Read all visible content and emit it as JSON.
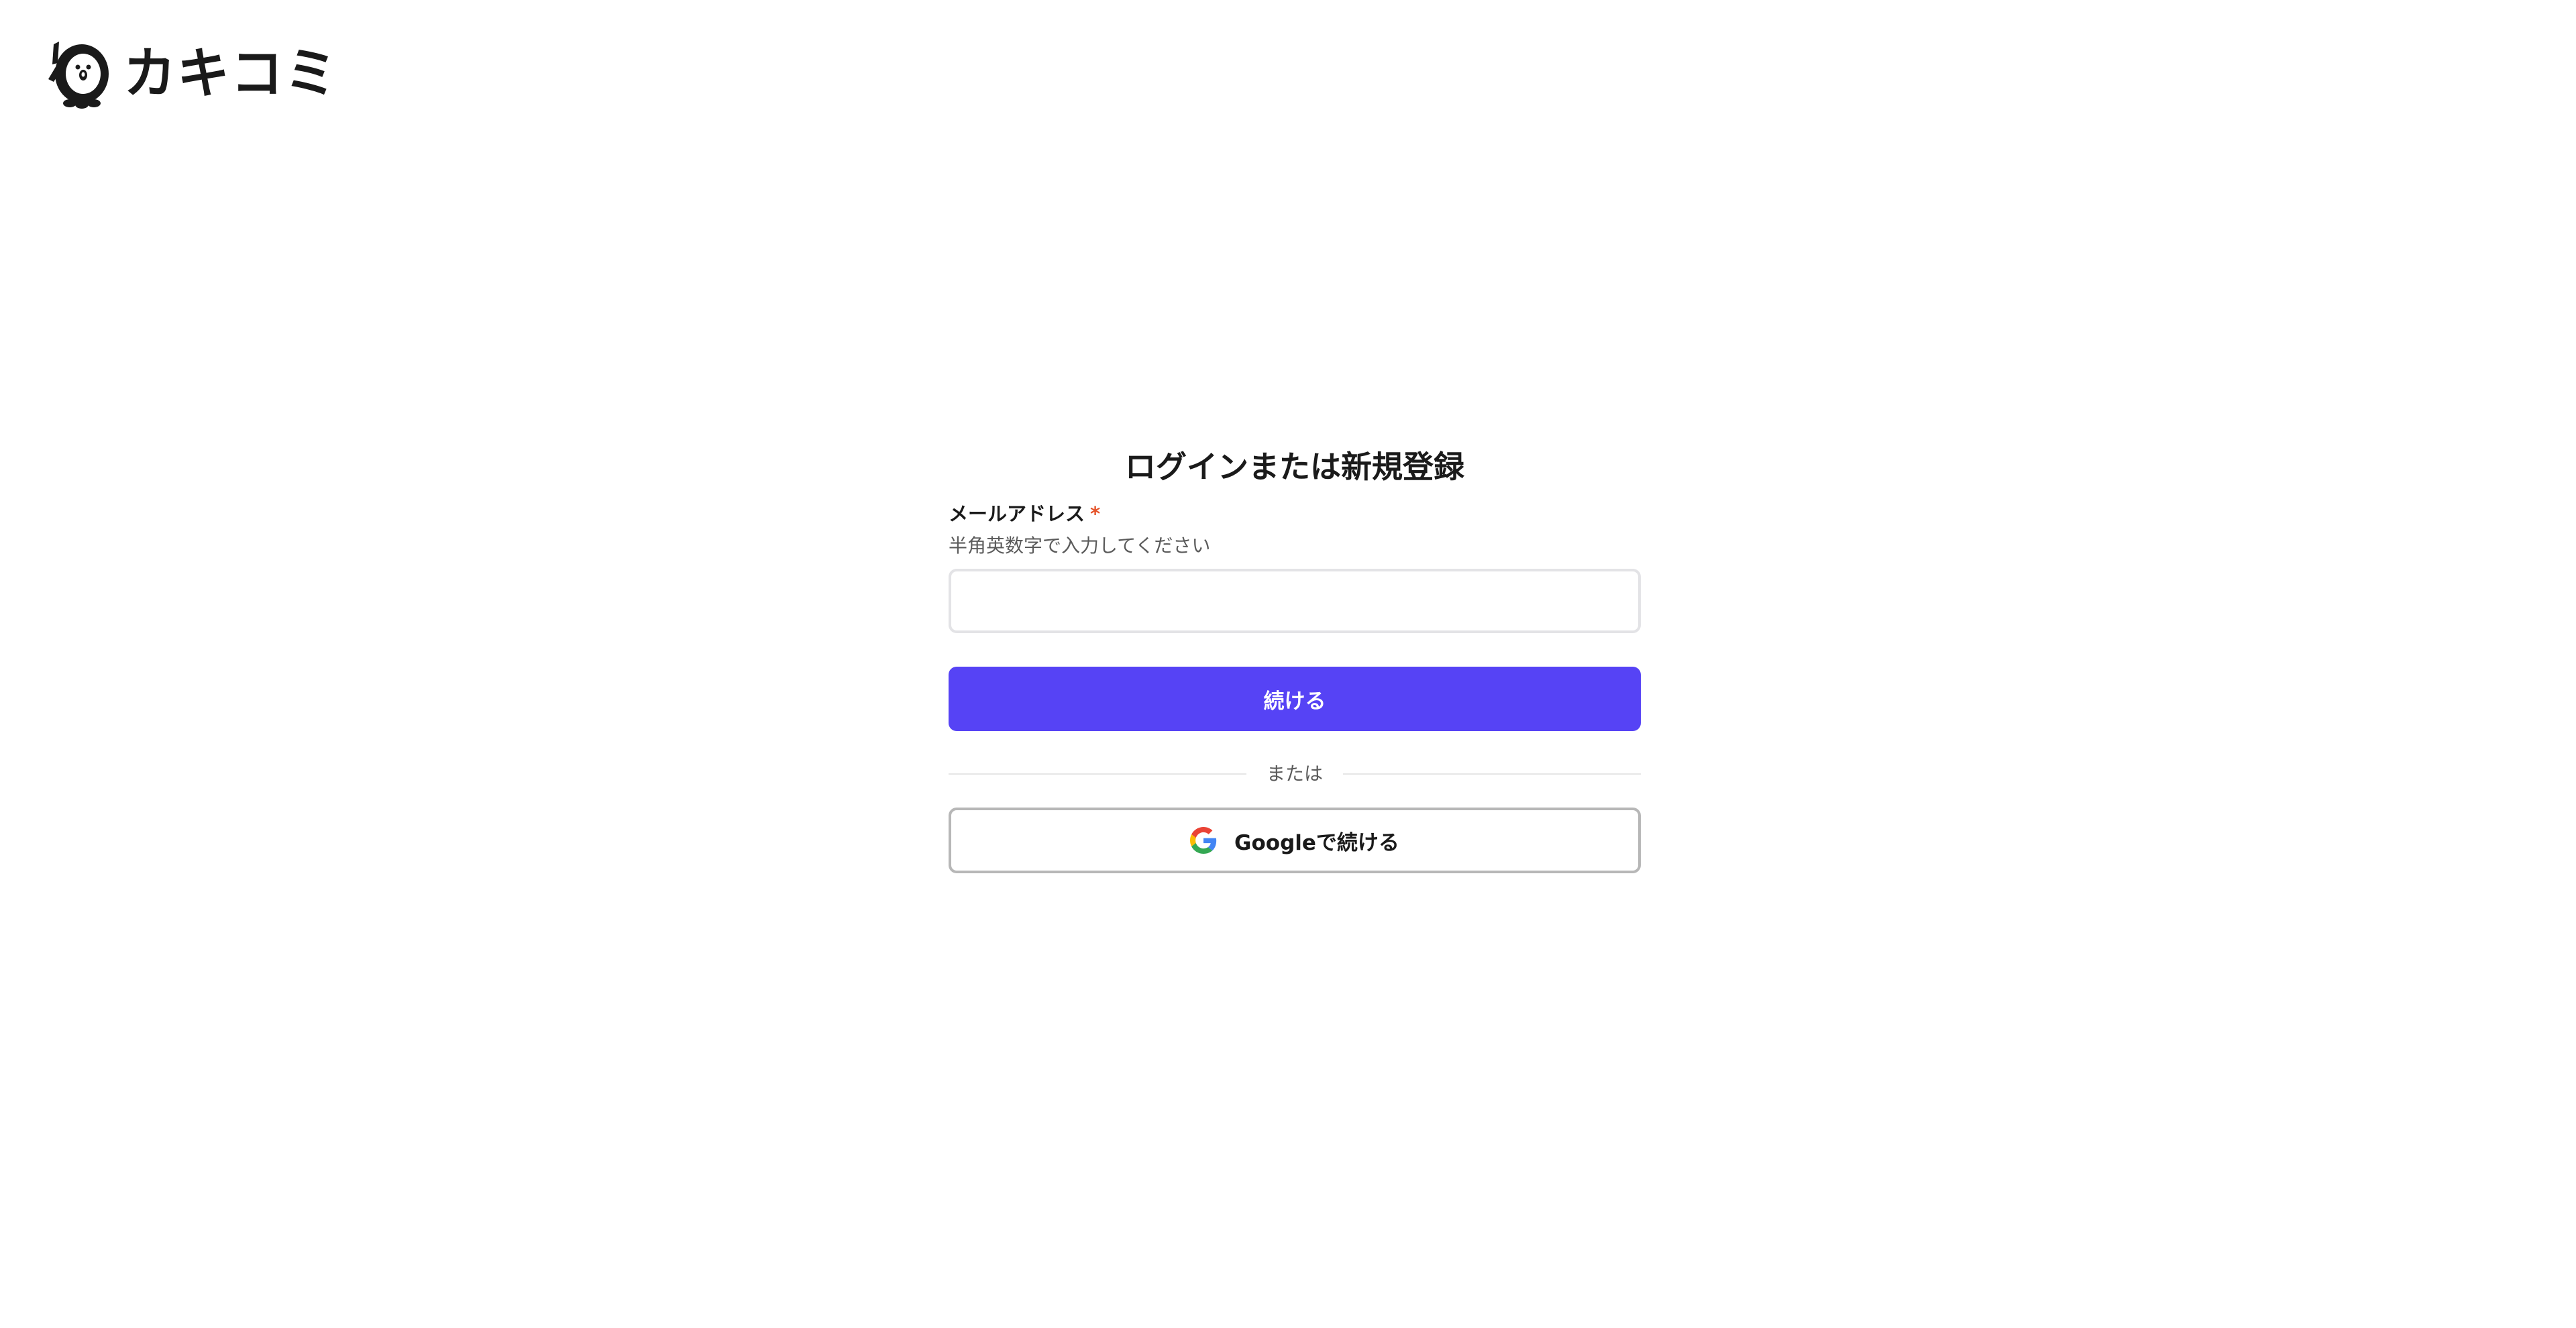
{
  "header": {
    "logo_text": "カキコミ"
  },
  "auth": {
    "title": "ログインまたは新規登録",
    "email_label": "メールアドレス",
    "required_mark": "*",
    "email_hint": "半角英数字で入力してください",
    "email_value": "",
    "email_placeholder": "",
    "continue_label": "続ける",
    "divider_text": "または",
    "google_label": "Googleで続ける"
  },
  "icons": {
    "logo_mascot": "penguin-mascot-icon",
    "google": "google-g-icon"
  },
  "colors": {
    "primary_button": "#5643f5",
    "required_mark": "#e5542b",
    "text": "#1a1a1a",
    "muted_text": "#5b5b5b"
  }
}
